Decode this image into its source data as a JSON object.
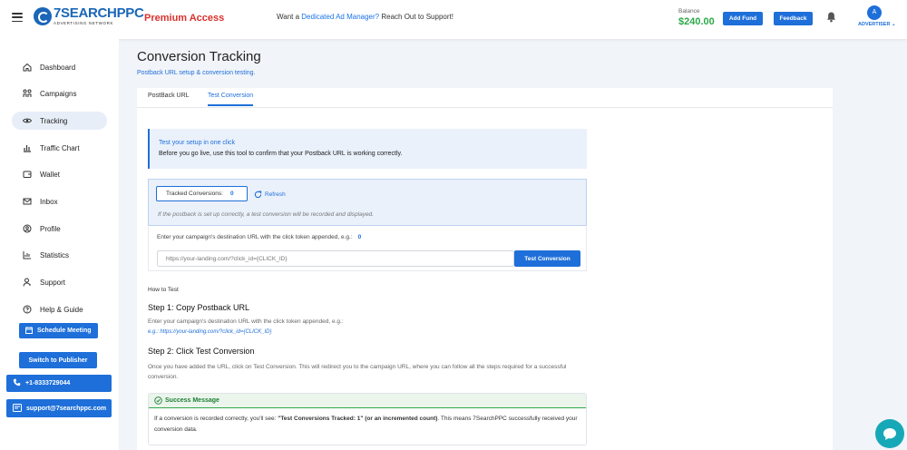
{
  "header": {
    "logo_name": "7SEARCHPPC",
    "logo_sub": "ADVERTISING NETWORK",
    "premium": "Premium Access",
    "promo_prefix": "Want a ",
    "promo_link": "Dedicated Ad Manager?",
    "promo_suffix": " Reach Out to Support!",
    "balance_label": "Balance",
    "balance_value": "$240.00",
    "add_fund": "Add Fund",
    "feedback": "Feedback",
    "avatar_initial": "A",
    "role": "ADVERTISER"
  },
  "sidebar": {
    "items": [
      {
        "label": "Dashboard",
        "icon": "home-icon"
      },
      {
        "label": "Campaigns",
        "icon": "campaigns-icon"
      },
      {
        "label": "Tracking",
        "icon": "eye-icon"
      },
      {
        "label": "Traffic Chart",
        "icon": "chart-icon"
      },
      {
        "label": "Wallet",
        "icon": "wallet-icon"
      },
      {
        "label": "Inbox",
        "icon": "inbox-icon"
      },
      {
        "label": "Profile",
        "icon": "profile-icon"
      },
      {
        "label": "Statistics",
        "icon": "statistics-icon"
      },
      {
        "label": "Support",
        "icon": "support-icon"
      },
      {
        "label": "Help & Guide",
        "icon": "help-icon"
      }
    ],
    "active": "Tracking",
    "schedule_meeting": "Schedule Meeting",
    "switch_publisher": "Switch to Publisher",
    "phone": "+1-8333729044",
    "email": "support@7searchppc.com"
  },
  "page": {
    "title": "Conversion Tracking",
    "subtitle": "Postback URL setup & conversion testing."
  },
  "tabs": [
    {
      "label": "PostBack URL",
      "active": false
    },
    {
      "label": "Test Conversion",
      "active": true
    }
  ],
  "info": {
    "title": "Test your setup in one click",
    "text": "Before you go live, use this tool to confirm that your Postback URL is working correctly."
  },
  "tracked": {
    "label": "Tracked Conversions:",
    "count": "0",
    "refresh": "Refresh",
    "note": "If the postback is set up correctly, a test conversion will be recorded and displayed."
  },
  "destination": {
    "label": "Enter your campaign's destination URL with the click token appended, e.g.:",
    "count": "0",
    "placeholder": "https://your-landing.com/?click_id={CLICK_ID}",
    "button": "Test Conversion"
  },
  "howto": {
    "heading": "How to Test",
    "step1_title": "Step 1: Copy Postback URL",
    "step1_text": "Enter your campaign's destination URL with the click token appended, e.g.:",
    "step1_example": "e.g.: https://your-landing.com/?click_id={CLICK_ID}",
    "step2_title": "Step 2: Click Test Conversion",
    "step2_text": "Once you have added the URL, click on Test Conversion. This will redirect you to the campaign URL, where you can follow all the steps required for a successful conversion."
  },
  "success": {
    "title": "Success Message",
    "text_prefix": "If a conversion is recorded correctly, you'll see: ",
    "text_bold": "\"Test Conversions Tracked: 1\" (or an incremented count)",
    "text_suffix": ". This means 7SearchPPC successfully received your conversion data."
  },
  "colors": {
    "accent": "#1e6fd9",
    "premium": "#d9302c",
    "balance": "#2ea84a",
    "chat": "#17a8b8"
  }
}
